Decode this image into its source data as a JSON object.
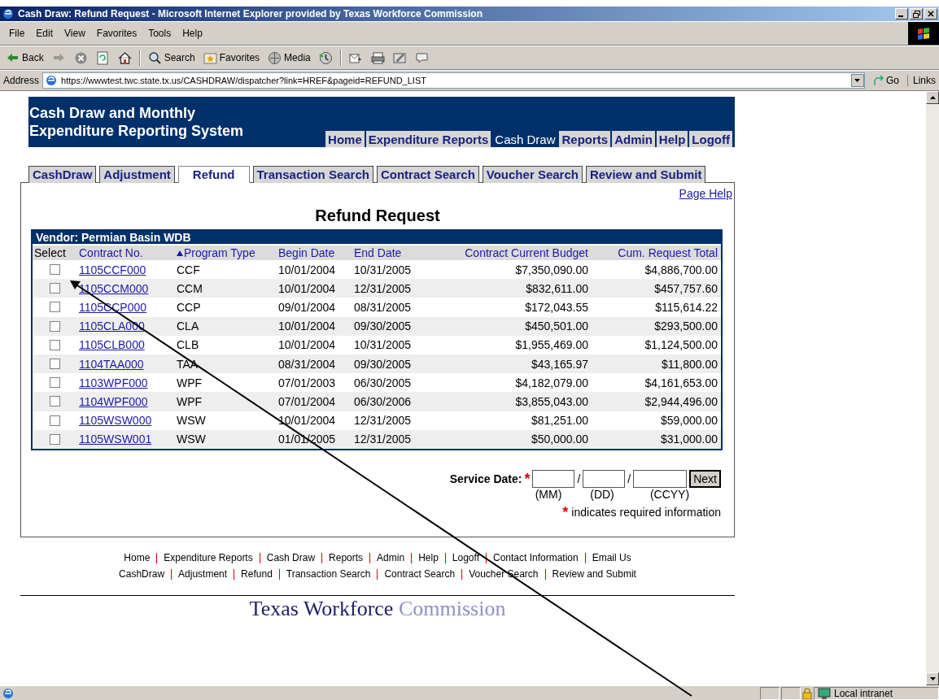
{
  "window": {
    "title": "Cash Draw: Refund Request - Microsoft Internet Explorer provided by Texas Workforce Commission"
  },
  "menu": [
    "File",
    "Edit",
    "View",
    "Favorites",
    "Tools",
    "Help"
  ],
  "toolbar": [
    {
      "kind": "back",
      "label": "Back"
    },
    {
      "kind": "forward"
    },
    {
      "kind": "stop"
    },
    {
      "kind": "refresh"
    },
    {
      "kind": "home"
    },
    {
      "kind": "search",
      "label": "Search"
    },
    {
      "kind": "favorites",
      "label": "Favorites"
    },
    {
      "kind": "media",
      "label": "Media"
    },
    {
      "kind": "history"
    },
    {
      "kind": "mail"
    },
    {
      "kind": "print"
    },
    {
      "kind": "edit"
    },
    {
      "kind": "discuss"
    }
  ],
  "address": {
    "label": "Address",
    "value": "https://wwwtest.twc.state.tx.us/CASHDRAW/dispatcher?link=HREF&pageid=REFUND_LIST",
    "go": "Go",
    "links": "Links"
  },
  "site": {
    "title_lines": [
      "Cash Draw and Monthly",
      "Expenditure Reporting System"
    ],
    "nav": [
      {
        "label": "Home",
        "selected": false
      },
      {
        "label": "Expenditure Reports",
        "selected": false
      },
      {
        "label": "Cash Draw",
        "selected": true
      },
      {
        "label": "Reports",
        "selected": false
      },
      {
        "label": "Admin",
        "selected": false
      },
      {
        "label": "Help",
        "selected": false
      },
      {
        "label": "Logoff",
        "selected": false
      }
    ]
  },
  "tabs": [
    {
      "label": "CashDraw",
      "selected": false
    },
    {
      "label": "Adjustment",
      "selected": false
    },
    {
      "label": "Refund",
      "selected": true
    },
    {
      "label": "Transaction Search",
      "selected": false
    },
    {
      "label": "Contract Search",
      "selected": false
    },
    {
      "label": "Voucher Search",
      "selected": false
    },
    {
      "label": "Review and Submit",
      "selected": false
    }
  ],
  "page_help": "Page Help",
  "heading": "Refund Request",
  "table": {
    "vendor": "Vendor: Permian Basin WDB",
    "columns": [
      {
        "label": "Select",
        "kind": "plain",
        "sorted": false
      },
      {
        "label": "Contract No.",
        "kind": "link",
        "sorted": false
      },
      {
        "label": "Program Type",
        "kind": "link",
        "sorted": true
      },
      {
        "label": "Begin Date",
        "kind": "link",
        "sorted": false
      },
      {
        "label": "End Date",
        "kind": "link",
        "sorted": false
      },
      {
        "label": "Contract Current Budget",
        "kind": "link",
        "sorted": false
      },
      {
        "label": "Cum. Request Total",
        "kind": "link",
        "sorted": false
      }
    ],
    "rows": [
      {
        "checked": false,
        "contract": "1105CCF000",
        "program": "CCF",
        "begin": "10/01/2004",
        "end": "10/31/2005",
        "budget": "$7,350,090.00",
        "total": "$4,886,700.00"
      },
      {
        "checked": false,
        "contract": "1105CCM000",
        "program": "CCM",
        "begin": "10/01/2004",
        "end": "12/31/2005",
        "budget": "$832,611.00",
        "total": "$457,757.60"
      },
      {
        "checked": false,
        "contract": "1105CCP000",
        "program": "CCP",
        "begin": "09/01/2004",
        "end": "08/31/2005",
        "budget": "$172,043.55",
        "total": "$115,614.22"
      },
      {
        "checked": false,
        "contract": "1105CLA000",
        "program": "CLA",
        "begin": "10/01/2004",
        "end": "09/30/2005",
        "budget": "$450,501.00",
        "total": "$293,500.00"
      },
      {
        "checked": false,
        "contract": "1105CLB000",
        "program": "CLB",
        "begin": "10/01/2004",
        "end": "10/31/2005",
        "budget": "$1,955,469.00",
        "total": "$1,124,500.00"
      },
      {
        "checked": false,
        "contract": "1104TAA000",
        "program": "TAA",
        "begin": "08/31/2004",
        "end": "09/30/2005",
        "budget": "$43,165.97",
        "total": "$11,800.00"
      },
      {
        "checked": false,
        "contract": "1103WPF000",
        "program": "WPF",
        "begin": "07/01/2003",
        "end": "06/30/2005",
        "budget": "$4,182,079.00",
        "total": "$4,161,653.00"
      },
      {
        "checked": false,
        "contract": "1104WPF000",
        "program": "WPF",
        "begin": "07/01/2004",
        "end": "06/30/2006",
        "budget": "$3,855,043.00",
        "total": "$2,944,496.00"
      },
      {
        "checked": false,
        "contract": "1105WSW000",
        "program": "WSW",
        "begin": "10/01/2004",
        "end": "12/31/2005",
        "budget": "$81,251.00",
        "total": "$59,000.00"
      },
      {
        "checked": false,
        "contract": "1105WSW001",
        "program": "WSW",
        "begin": "01/01/2005",
        "end": "12/31/2005",
        "budget": "$50,000.00",
        "total": "$31,000.00"
      }
    ]
  },
  "service_date": {
    "label": "Service Date:",
    "required_mark": "*",
    "fields": [
      {
        "hint": "(MM)"
      },
      {
        "hint": "(DD)"
      },
      {
        "hint": "(CCYY)"
      }
    ],
    "separators": [
      "/",
      "/"
    ],
    "button": "Next"
  },
  "note": {
    "mark": "*",
    "text": "indicates required information"
  },
  "footer_links": [
    [
      "Home",
      "Expenditure Reports",
      "Cash Draw",
      "Reports",
      "Admin",
      "Help",
      "Logoff",
      "Contact Information",
      "Email Us"
    ],
    [
      "CashDraw",
      "Adjustment",
      "Refund",
      "Transaction Search",
      "Contract Search",
      "Voucher Search",
      "Review and Submit"
    ]
  ],
  "logo": {
    "primary": "Texas Workforce",
    "secondary": "Commission"
  },
  "status_bar": {
    "zone": "Local intranet"
  }
}
